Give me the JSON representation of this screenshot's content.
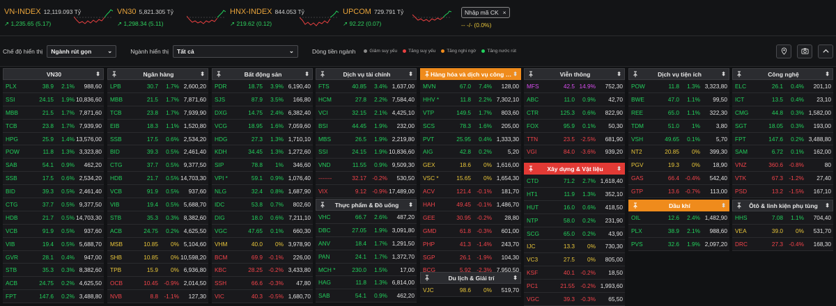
{
  "indices": [
    {
      "name": "VN-INDEX",
      "value": "12,119.093 Tỷ",
      "change": "1,235.65 (5.17)"
    },
    {
      "name": "VN30",
      "value": "5,821.305 Tỷ",
      "change": "1,298.34 (5.11)"
    },
    {
      "name": "HNX-INDEX",
      "value": "844.053 Tỷ",
      "change": "219.62 (0.12)"
    },
    {
      "name": "UPCOM",
      "value": "729.791 Tỷ",
      "change": "92.22 (0.07)"
    }
  ],
  "colors": {
    "up": "#22d05c",
    "down": "#f2434a",
    "ref": "#e8c53a",
    "ceil": "#d84ef0",
    "accent": "#e8a33a"
  },
  "ck_input": {
    "label": "Nhập mã CK",
    "close": "×",
    "line": "--   -/- (0.0%)"
  },
  "controls": {
    "mode_label": "Chế độ hiển thị",
    "mode_value": "Ngành rút gọn",
    "industry_label": "Ngành hiển thị",
    "industry_value": "Tất cả",
    "flow_label": "Dòng tiền ngành",
    "legend": [
      "Giảm suy yếu",
      "Tăng suy yếu",
      "Tăng nghi ngờ",
      "Tăng nước rút"
    ]
  },
  "cards": [
    {
      "title": "VN30",
      "style": "plain",
      "rows": [
        [
          "PLX",
          "38.9",
          "2.1%",
          "988,60",
          "up"
        ],
        [
          "SSI",
          "24.15",
          "1.9%",
          "10,836,60",
          "up"
        ],
        [
          "MBB",
          "21.5",
          "1.7%",
          "7,871,60",
          "up"
        ],
        [
          "TCB",
          "23.8",
          "1.7%",
          "7,939,90",
          "up"
        ],
        [
          "HPG",
          "25.9",
          "1.4%",
          "13,576,00",
          "up"
        ],
        [
          "POW",
          "11.8",
          "1.3%",
          "3,323,80",
          "up"
        ],
        [
          "SAB",
          "54.1",
          "0.9%",
          "462,20",
          "up"
        ],
        [
          "SSB",
          "17.5",
          "0.6%",
          "2,534,20",
          "up"
        ],
        [
          "BID",
          "39.3",
          "0.5%",
          "2,461,40",
          "up"
        ],
        [
          "CTG",
          "37.7",
          "0.5%",
          "9,377,50",
          "up"
        ],
        [
          "HDB",
          "21.7",
          "0.5%",
          "14,703,30",
          "up"
        ],
        [
          "VCB",
          "91.9",
          "0.5%",
          "937,60",
          "up"
        ],
        [
          "VIB",
          "19.4",
          "0.5%",
          "5,688,70",
          "up"
        ],
        [
          "GVR",
          "28.1",
          "0.4%",
          "947,00",
          "up"
        ],
        [
          "STB",
          "35.3",
          "0.3%",
          "8,382,60",
          "up"
        ],
        [
          "ACB",
          "24.75",
          "0.2%",
          "4,625,50",
          "up"
        ],
        [
          "FPT",
          "147.6",
          "0.2%",
          "3,488,80",
          "up"
        ]
      ]
    },
    {
      "title": "Ngân hàng",
      "style": "plain",
      "rows": [
        [
          "LPB",
          "30.7",
          "1.7%",
          "2,600,20",
          "up"
        ],
        [
          "MBB",
          "21.5",
          "1.7%",
          "7,871,60",
          "up"
        ],
        [
          "TCB",
          "23.8",
          "1.7%",
          "7,939,90",
          "up"
        ],
        [
          "EIB",
          "18.3",
          "1.1%",
          "1,520,80",
          "up"
        ],
        [
          "SSB",
          "17.5",
          "0.6%",
          "2,534,20",
          "up"
        ],
        [
          "BID",
          "39.3",
          "0.5%",
          "2,461,40",
          "up"
        ],
        [
          "CTG",
          "37.7",
          "0.5%",
          "9,377,50",
          "up"
        ],
        [
          "HDB",
          "21.7",
          "0.5%",
          "14,703,30",
          "up"
        ],
        [
          "VCB",
          "91.9",
          "0.5%",
          "937,60",
          "up"
        ],
        [
          "VIB",
          "19.4",
          "0.5%",
          "5,688,70",
          "up"
        ],
        [
          "STB",
          "35.3",
          "0.3%",
          "8,382,60",
          "up"
        ],
        [
          "ACB",
          "24.75",
          "0.2%",
          "4,625,50",
          "up"
        ],
        [
          "MSB",
          "10.85",
          "0%",
          "5,104,60",
          "ref"
        ],
        [
          "SHB",
          "10.85",
          "0%",
          "10,598,20",
          "ref"
        ],
        [
          "TPB",
          "15.9",
          "0%",
          "6,936,80",
          "ref"
        ],
        [
          "OCB",
          "10.45",
          "-0.9%",
          "2,014,50",
          "dn"
        ],
        [
          "NVB",
          "8.8",
          "-1.1%",
          "127,30",
          "dn"
        ]
      ]
    },
    {
      "title": "Bất động sản",
      "style": "plain",
      "rows": [
        [
          "PDR",
          "18.75",
          "3.9%",
          "6,190,40",
          "up"
        ],
        [
          "SJS",
          "87.9",
          "3.5%",
          "166,80",
          "up"
        ],
        [
          "DXG",
          "14.75",
          "2.4%",
          "6,382,40",
          "up"
        ],
        [
          "VCG",
          "18.95",
          "1.6%",
          "7,059,60",
          "up"
        ],
        [
          "HDG",
          "27.3",
          "1.3%",
          "1,710,10",
          "up"
        ],
        [
          "KDH",
          "34.45",
          "1.3%",
          "1,272,60",
          "up"
        ],
        [
          "SIP",
          "78.8",
          "1%",
          "346,60",
          "up"
        ],
        [
          "VPI *",
          "59.1",
          "0.9%",
          "1,076,40",
          "up"
        ],
        [
          "NLG",
          "32.4",
          "0.8%",
          "1,687,90",
          "up"
        ],
        [
          "IDC",
          "53.8",
          "0.7%",
          "802,60",
          "up"
        ],
        [
          "DIG",
          "18.0",
          "0.6%",
          "7,211,10",
          "up"
        ],
        [
          "VGC",
          "47.65",
          "0.1%",
          "660,30",
          "up"
        ],
        [
          "VHM",
          "40.0",
          "0%",
          "3,978,90",
          "ref"
        ],
        [
          "BCM",
          "69.9",
          "-0.1%",
          "226,00",
          "dn"
        ],
        [
          "KBC",
          "28.25",
          "-0.2%",
          "3,433,80",
          "dn"
        ],
        [
          "SSH",
          "66.6",
          "-0.3%",
          "47,80",
          "dn"
        ],
        [
          "VIC",
          "40.3",
          "-0.5%",
          "1,680,70",
          "dn"
        ]
      ]
    },
    {
      "title": "Dịch vụ tài chính",
      "style": "plain",
      "rows": [
        [
          "FTS",
          "40.85",
          "3.4%",
          "1,637,00",
          "up"
        ],
        [
          "HCM",
          "27.8",
          "2.2%",
          "7,584,40",
          "up"
        ],
        [
          "VCI",
          "32.15",
          "2.1%",
          "4,425,10",
          "up"
        ],
        [
          "BSI",
          "44.45",
          "1.9%",
          "232,00",
          "up"
        ],
        [
          "MBS",
          "26.5",
          "1.9%",
          "2,219,80",
          "up"
        ],
        [
          "SSI",
          "24.15",
          "1.9%",
          "10,836,60",
          "up"
        ],
        [
          "VND",
          "11.55",
          "0.9%",
          "9,509,30",
          "up"
        ],
        [
          "-------",
          "32.17",
          "-0.2%",
          "530,50",
          "dn"
        ],
        [
          "VIX",
          "9.12",
          "-0.9%",
          "17,489,00",
          "dn"
        ]
      ]
    },
    {
      "title": "Thực phẩm & Đồ uống",
      "style": "plain",
      "rows": [
        [
          "VHC",
          "66.7",
          "2.6%",
          "487,20",
          "up"
        ],
        [
          "DBC",
          "27.05",
          "1.9%",
          "3,091,80",
          "up"
        ],
        [
          "ANV",
          "18.4",
          "1.7%",
          "1,291,50",
          "up"
        ],
        [
          "PAN",
          "24.1",
          "1.7%",
          "1,372,70",
          "up"
        ],
        [
          "MCH *",
          "230.0",
          "1.5%",
          "17,00",
          "up"
        ],
        [
          "HAG",
          "11.8",
          "1.3%",
          "6,814,00",
          "up"
        ],
        [
          "SAB",
          "54.1",
          "0.9%",
          "462,20",
          "up"
        ]
      ]
    },
    {
      "title": "Hàng hóa và dịch vụ công ng...",
      "style": "orange",
      "rows": [
        [
          "MVN",
          "67.0",
          "7.4%",
          "128,00",
          "up"
        ],
        [
          "HHV *",
          "11.8",
          "2.2%",
          "7,302,10",
          "up"
        ],
        [
          "VTP",
          "149.5",
          "1.7%",
          "803,60",
          "up"
        ],
        [
          "SCS",
          "78.3",
          "1.6%",
          "205,00",
          "up"
        ],
        [
          "PVT",
          "25.95",
          "0.4%",
          "1,333,30",
          "up"
        ],
        [
          "AIG",
          "42.8",
          "0.2%",
          "5,20",
          "up"
        ],
        [
          "GEX",
          "18.6",
          "0%",
          "1,616,00",
          "ref"
        ],
        [
          "VSC *",
          "15.65",
          "0%",
          "1,654,30",
          "ref"
        ],
        [
          "ACV",
          "121.4",
          "-0.1%",
          "181,70",
          "dn"
        ],
        [
          "HAH",
          "49.45",
          "-0.1%",
          "1,486,70",
          "dn"
        ],
        [
          "GEE",
          "30.95",
          "-0.2%",
          "28,80",
          "dn"
        ],
        [
          "GMD",
          "61.8",
          "-0.3%",
          "601,00",
          "dn"
        ],
        [
          "PHP",
          "41.3",
          "-1.4%",
          "243,70",
          "dn"
        ],
        [
          "SGP",
          "26.1",
          "-1.9%",
          "104,30",
          "dn"
        ],
        [
          "BCG",
          "5.92",
          "-2.3%",
          "7,950,50",
          "dn"
        ]
      ]
    },
    {
      "title": "Du lịch & Giải trí",
      "style": "plain",
      "rows": [
        [
          "VJC",
          "98.6",
          "0%",
          "519,70",
          "ref"
        ]
      ]
    },
    {
      "title": "Viễn thông",
      "style": "plain",
      "rows": [
        [
          "MFS",
          "42.5",
          "14.9%",
          "752,30",
          "ce"
        ],
        [
          "ABC",
          "11.0",
          "0.9%",
          "42,70",
          "up"
        ],
        [
          "CTR",
          "125.3",
          "0.6%",
          "822,90",
          "up"
        ],
        [
          "FOX",
          "95.9",
          "0.1%",
          "50,30",
          "up"
        ],
        [
          "TTN",
          "23.5",
          "-2.5%",
          "681,90",
          "dn"
        ],
        [
          "VGI",
          "84.0",
          "-3.6%",
          "939,20",
          "dn"
        ]
      ]
    },
    {
      "title": "Xây dựng & Vật liệu",
      "style": "red",
      "rows": [
        [
          "CTD",
          "71.2",
          "2.7%",
          "1,618,40",
          "up"
        ],
        [
          "HT1",
          "11.9",
          "1.3%",
          "352,10",
          "up"
        ],
        [
          "HUT",
          "16.0",
          "0.6%",
          "418,50",
          "up"
        ],
        [
          "NTP",
          "58.0",
          "0.2%",
          "231,90",
          "up"
        ],
        [
          "SCG",
          "65.0",
          "0.2%",
          "43,90",
          "up"
        ],
        [
          "IJC",
          "13.3",
          "0%",
          "730,30",
          "ref"
        ],
        [
          "VC3",
          "27.5",
          "0%",
          "805,00",
          "ref"
        ],
        [
          "KSF",
          "40.1",
          "-0.2%",
          "18,50",
          "dn"
        ],
        [
          "PC1",
          "21.55",
          "-0.2%",
          "1,993,60",
          "dn"
        ],
        [
          "VGC",
          "39.3",
          "-0.3%",
          "65,50",
          "dn"
        ]
      ]
    },
    {
      "title": "Dịch vụ tiện ích",
      "style": "plain",
      "rows": [
        [
          "POW",
          "11.8",
          "1.3%",
          "3,323,80",
          "up"
        ],
        [
          "BWE",
          "47.0",
          "1.1%",
          "99,50",
          "up"
        ],
        [
          "REE",
          "65.0",
          "1.1%",
          "322,30",
          "up"
        ],
        [
          "TDM",
          "51.0",
          "1%",
          "3,80",
          "up"
        ],
        [
          "VSH",
          "49.65",
          "0.1%",
          "5,70",
          "up"
        ],
        [
          "NT2",
          "20.85",
          "0%",
          "399,30",
          "ref"
        ],
        [
          "PGV",
          "19.3",
          "0%",
          "18,90",
          "ref"
        ],
        [
          "GAS",
          "66.4",
          "-0.4%",
          "542,40",
          "dn"
        ],
        [
          "GTP",
          "13.6",
          "-0.7%",
          "113,00",
          "dn"
        ]
      ]
    },
    {
      "title": "Dầu khí",
      "style": "orange",
      "rows": [
        [
          "OIL",
          "12.6",
          "2.4%",
          "1,482,90",
          "up"
        ],
        [
          "PLX",
          "38.9",
          "2.1%",
          "988,60",
          "up"
        ],
        [
          "PVS",
          "32.6",
          "1.9%",
          "2,097,20",
          "up"
        ]
      ]
    },
    {
      "title": "Công nghệ",
      "style": "plain",
      "rows": [
        [
          "ELC",
          "26.1",
          "0.4%",
          "201,10",
          "up"
        ],
        [
          "ICT",
          "13.5",
          "0.4%",
          "23,10",
          "up"
        ],
        [
          "CMG",
          "44.8",
          "0.3%",
          "1,582,00",
          "up"
        ],
        [
          "SGT",
          "18.05",
          "0.3%",
          "193,00",
          "up"
        ],
        [
          "FPT",
          "147.6",
          "0.2%",
          "3,488,80",
          "up"
        ],
        [
          "SAM",
          "6.72",
          "0.1%",
          "162,00",
          "up"
        ],
        [
          "VNZ",
          "360.6",
          "-0.8%",
          "80",
          "dn"
        ],
        [
          "VTK",
          "67.3",
          "-1.2%",
          "27,40",
          "dn"
        ],
        [
          "PSD",
          "13.2",
          "-1.5%",
          "167,10",
          "dn"
        ]
      ]
    },
    {
      "title": "Ôtô & linh kiện phụ tùng",
      "style": "plain",
      "rows": [
        [
          "HHS",
          "7.08",
          "1.1%",
          "704,40",
          "up"
        ],
        [
          "VEA",
          "39.0",
          "0%",
          "531,70",
          "ref"
        ],
        [
          "DRC",
          "27.3",
          "-0.4%",
          "168,30",
          "dn"
        ]
      ]
    }
  ]
}
